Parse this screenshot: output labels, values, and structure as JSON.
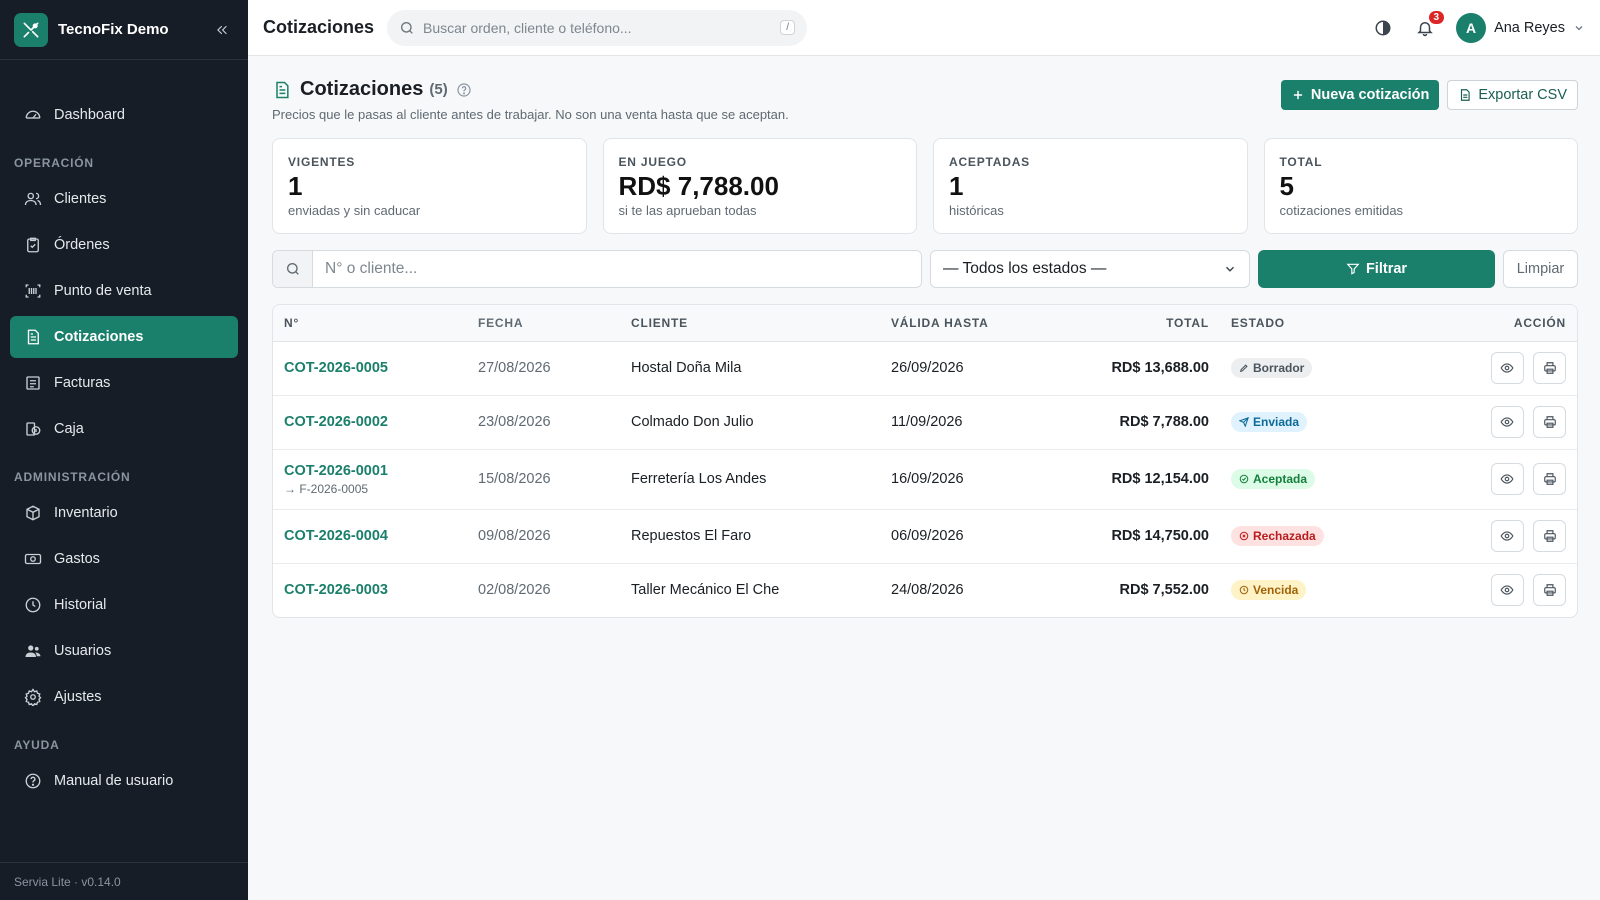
{
  "brand": {
    "name": "TecnoFix Demo"
  },
  "sidebar": {
    "items": [
      {
        "label": "Dashboard"
      },
      {
        "label": "Clientes"
      },
      {
        "label": "Órdenes"
      },
      {
        "label": "Punto de venta"
      },
      {
        "label": "Cotizaciones"
      },
      {
        "label": "Facturas"
      },
      {
        "label": "Caja"
      },
      {
        "label": "Inventario"
      },
      {
        "label": "Gastos"
      },
      {
        "label": "Historial"
      },
      {
        "label": "Usuarios"
      },
      {
        "label": "Ajustes"
      },
      {
        "label": "Manual de usuario"
      }
    ],
    "sections": {
      "operacion": "OPERACIÓN",
      "administracion": "ADMINISTRACIÓN",
      "ayuda": "AYUDA"
    },
    "footer": "Servia Lite · v0.14.0"
  },
  "topbar": {
    "title": "Cotizaciones",
    "search_placeholder": "Buscar orden, cliente o teléfono...",
    "search_shortcut": "/",
    "notifications_count": "3",
    "user": {
      "initial": "A",
      "name": "Ana Reyes"
    }
  },
  "page": {
    "title": "Cotizaciones",
    "count": "(5)",
    "subtitle": "Precios que le pasas al cliente antes de trabajar. No son una venta hasta que se aceptan.",
    "new_button": "Nueva cotización",
    "export_button": "Exportar CSV"
  },
  "stats": [
    {
      "label": "VIGENTES",
      "value": "1",
      "sub": "enviadas y sin caducar"
    },
    {
      "label": "EN JUEGO",
      "value": "RD$ 7,788.00",
      "sub": "si te las aprueban todas"
    },
    {
      "label": "ACEPTADAS",
      "value": "1",
      "sub": "históricas"
    },
    {
      "label": "TOTAL",
      "value": "5",
      "sub": "cotizaciones emitidas"
    }
  ],
  "filters": {
    "search_placeholder": "N° o cliente...",
    "status_selected": "— Todos los estados —",
    "filter_button": "Filtrar",
    "clear_button": "Limpiar"
  },
  "table": {
    "headers": {
      "no": "N°",
      "fecha": "FECHA",
      "cliente": "CLIENTE",
      "valida": "VÁLIDA HASTA",
      "total": "TOTAL",
      "estado": "ESTADO",
      "accion": "ACCIÓN"
    },
    "rows": [
      {
        "no": "COT-2026-0005",
        "ref": "",
        "fecha": "27/08/2026",
        "cliente": "Hostal Doña Mila",
        "valida": "26/09/2026",
        "total": "RD$ 13,688.00",
        "estado": "Borrador"
      },
      {
        "no": "COT-2026-0002",
        "ref": "",
        "fecha": "23/08/2026",
        "cliente": "Colmado Don Julio",
        "valida": "11/09/2026",
        "total": "RD$ 7,788.00",
        "estado": "Enviada"
      },
      {
        "no": "COT-2026-0001",
        "ref": "→ F-2026-0005",
        "fecha": "15/08/2026",
        "cliente": "Ferretería Los Andes",
        "valida": "16/09/2026",
        "total": "RD$ 12,154.00",
        "estado": "Aceptada"
      },
      {
        "no": "COT-2026-0004",
        "ref": "",
        "fecha": "09/08/2026",
        "cliente": "Repuestos El Faro",
        "valida": "06/09/2026",
        "total": "RD$ 14,750.00",
        "estado": "Rechazada"
      },
      {
        "no": "COT-2026-0003",
        "ref": "",
        "fecha": "02/08/2026",
        "cliente": "Taller Mecánico El Che",
        "valida": "24/08/2026",
        "total": "RD$ 7,552.00",
        "estado": "Vencida"
      }
    ]
  },
  "colors": {
    "accent": "#1a7f6b",
    "sidebar_bg": "#161d26",
    "danger": "#dc2626"
  }
}
